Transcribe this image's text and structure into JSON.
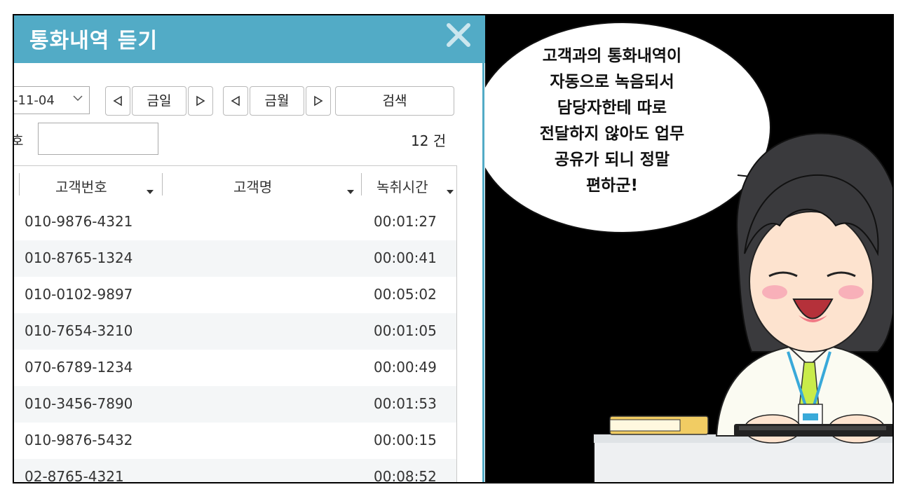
{
  "window": {
    "title": "통화내역 듣기"
  },
  "toolbar": {
    "date_value": "-11-04",
    "today_label": "금일",
    "month_label": "금월",
    "search_label": "검색",
    "phone_label": "호",
    "phone_value": "",
    "count_text": "12 건"
  },
  "table": {
    "headers": [
      "고객번호",
      "고객명",
      "녹취시간"
    ],
    "rows": [
      {
        "phone": "010-9876-4321",
        "name": "",
        "duration": "00:01:27"
      },
      {
        "phone": "010-8765-1324",
        "name": "",
        "duration": "00:00:41"
      },
      {
        "phone": "010-0102-9897",
        "name": "",
        "duration": "00:05:02"
      },
      {
        "phone": "010-7654-3210",
        "name": "",
        "duration": "00:01:05"
      },
      {
        "phone": "070-6789-1234",
        "name": "",
        "duration": "00:00:49"
      },
      {
        "phone": "010-3456-7890",
        "name": "",
        "duration": "00:01:53"
      },
      {
        "phone": "010-9876-5432",
        "name": "",
        "duration": "00:00:15"
      },
      {
        "phone": "02-8765-4321",
        "name": "",
        "duration": "00:08:52"
      }
    ]
  },
  "comic": {
    "speech_lines": [
      "고객과의 통화내역이",
      "자동으로 녹음되서",
      "담당자한테 따로",
      "전달하지 않아도 업무",
      "공유가 되니 정말",
      "편하군!"
    ]
  },
  "colors": {
    "titlebar": "#52abc6",
    "row_alt": "#f4f6f7",
    "comic_bg": "#000000"
  }
}
